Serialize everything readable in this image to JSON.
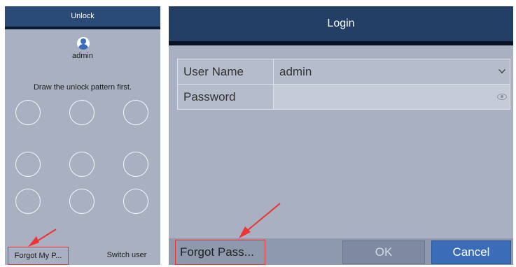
{
  "unlock": {
    "title": "Unlock",
    "username": "admin",
    "message": "Draw the unlock pattern first.",
    "pattern_dots": 9,
    "forgot_label": "Forgot My P...",
    "switch_user_label": "Switch user"
  },
  "login": {
    "title": "Login",
    "fields": {
      "username_label": "User Name",
      "username_value": "admin",
      "password_label": "Password",
      "password_value": ""
    },
    "forgot_label": "Forgot Pass...",
    "ok_label": "OK",
    "cancel_label": "Cancel"
  },
  "colors": {
    "header": "#2a4a77",
    "panel": "#a9b0c1",
    "annotation": "#ee3333",
    "cancel": "#3b6cb7"
  },
  "icons": {
    "avatar": "user-avatar-icon",
    "dropdown": "chevron-down-icon",
    "reveal": "eye-icon",
    "annotation": "red-arrow"
  }
}
